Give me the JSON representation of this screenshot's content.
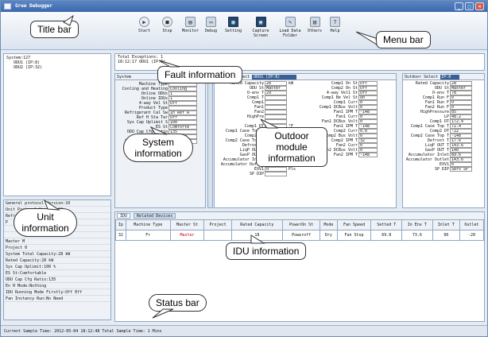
{
  "window": {
    "title": "Gree Debugger",
    "controls": [
      "_",
      "□",
      "×"
    ]
  },
  "toolbar": {
    "items": [
      {
        "label": "Start",
        "icon": "play-icon"
      },
      {
        "label": "Stop",
        "icon": "stop-icon"
      },
      {
        "label": "Monitor",
        "icon": "monitor-icon"
      },
      {
        "label": "Debug",
        "icon": "debug-icon"
      },
      {
        "label": "Setting",
        "icon": "setting-icon"
      },
      {
        "label": "Capture Screen",
        "icon": "capture-icon"
      },
      {
        "label": "Load Data Folder",
        "icon": "folder-icon"
      },
      {
        "label": "Others",
        "icon": "others-icon"
      },
      {
        "label": "Help",
        "icon": "help-icon"
      }
    ]
  },
  "tree": {
    "root": "System:127",
    "children": [
      "ODU1 (IP:8)",
      "ODU2 (IP:32)"
    ]
  },
  "unit_info": {
    "items": [
      "General protocol Version:10",
      "Unit Protocol Version:10",
      "Refrigerant",
      "P",
      "",
      "",
      "Master M",
      "Project 0",
      "System Total Capacity:28 kW",
      "Rated Capacity:28 kW",
      "Sys Cap Uplimit:100 %",
      "ES St:Comfortable",
      "ODU Cap Cfg Ratio:135",
      "En H Mode:Nothing",
      "IDU Running Mode Firstly:Off Eff",
      "Fan Instancy Run:No Need"
    ]
  },
  "fault": {
    "total_label": "Total Exceptions: 1",
    "line": "18:12:17 ODU1 (IP:8)"
  },
  "system": {
    "header": "System",
    "rows": [
      {
        "label": "Machine Type",
        "value": ""
      },
      {
        "label": "Cooling and Heating",
        "value": "Cooling"
      },
      {
        "label": "Online ODUs",
        "value": "1"
      },
      {
        "label": "Online IDUs",
        "value": "1"
      },
      {
        "label": "4-way Vel St",
        "value": "Off"
      },
      {
        "label": "Product Type",
        "value": ""
      },
      {
        "label": "Refrigerant Cal Sw",
        "value": "In Ref R"
      },
      {
        "label": "Ref H Sta Tar",
        "value": "Off"
      },
      {
        "label": "Sys Cap Uplimit S",
        "value": "100"
      },
      {
        "label": "ES St",
        "value": "Comforte"
      },
      {
        "label": "ODU Cap Cfg Ratio",
        "value": "135"
      },
      {
        "label": "En H Mode",
        "value": "Nothing"
      },
      {
        "label": "IDU Running Mode F",
        "value": "Off Effe"
      }
    ],
    "units": {
      "capacity": "%",
      "uplimit": "%"
    }
  },
  "outdoor": {
    "select_label": "Outdoor Select",
    "selected": "ODU1 (IP:8)",
    "left": [
      {
        "label": "Rated Capacity",
        "value": "28",
        "unit": "kW"
      },
      {
        "label": "ODU St",
        "value": "Master",
        "unit": ""
      },
      {
        "label": "O-env T",
        "value": "29",
        "unit": ""
      },
      {
        "label": "Comp1 T",
        "value": "",
        "unit": ""
      },
      {
        "label": "Comp1",
        "value": "",
        "unit": ""
      },
      {
        "label": "Fan1",
        "value": "",
        "unit": ""
      },
      {
        "label": "Fan2",
        "value": "",
        "unit": ""
      },
      {
        "label": "HighPre",
        "value": "",
        "unit": ""
      },
      {
        "label": "",
        "value": "",
        "unit": ""
      },
      {
        "label": "Comp1 DT",
        "value": "",
        "unit": "°F"
      },
      {
        "label": "Comp1 Case Top T",
        "value": "72.4",
        "unit": "°F"
      },
      {
        "label": "Comp2 DT",
        "value": "-22",
        "unit": "°F"
      },
      {
        "label": "Comp2 Case Top T",
        "value": "-148",
        "unit": "°F"
      },
      {
        "label": "Defrost T",
        "value": "17.6",
        "unit": "°F"
      },
      {
        "label": "LiqP OUT T",
        "value": "143.6",
        "unit": "°F"
      },
      {
        "label": "GasP OUT T",
        "value": "140",
        "unit": "°F"
      },
      {
        "label": "Accumulator Inlet",
        "value": "89.6",
        "unit": "°F"
      },
      {
        "label": "Accumulator Outlet",
        "value": "143.6",
        "unit": "°F"
      },
      {
        "label": "EXV1",
        "value": "0",
        "unit": "Pls"
      },
      {
        "label": "SP DIP",
        "value": "",
        "unit": ""
      }
    ],
    "right": [
      {
        "label": "Comp1 On St",
        "value": "Off"
      },
      {
        "label": "Comp2 On St",
        "value": "Off"
      },
      {
        "label": "4-way Vel1 St",
        "value": "Off"
      },
      {
        "label": "Comp1 Be Vel St",
        "value": "On"
      },
      {
        "label": "Comp1 Curr",
        "value": "0"
      },
      {
        "label": "Comp1 DCBus Volt",
        "value": "0"
      },
      {
        "label": "Fan1 IPM T",
        "value": "-148"
      },
      {
        "label": "Fan1 Curr",
        "value": "0"
      },
      {
        "label": "Fan1 DCBus Volt",
        "value": "0"
      },
      {
        "label": "Fan1 IPM T",
        "value": "-148"
      },
      {
        "label": "Comp2 Curr",
        "value": "0.0"
      },
      {
        "label": "Comp2 Bus Volt",
        "value": "0"
      },
      {
        "label": "Comp2 IPM T",
        "value": "32"
      },
      {
        "label": "Fan2 Curr",
        "value": "0"
      },
      {
        "label": "Fan2 DCBus Volt",
        "value": "0"
      },
      {
        "label": "Fan2 IPM T",
        "value": "-148"
      }
    ]
  },
  "outdoor2": {
    "select_label": "Outdoor Select",
    "selected": "IP:8",
    "rows": [
      {
        "label": "Rated Capacity",
        "value": "28"
      },
      {
        "label": "ODU St",
        "value": "Master"
      },
      {
        "label": "O-env T",
        "value": "78"
      },
      {
        "label": "Comp1 Run F",
        "value": "0"
      },
      {
        "label": "Fan1 Run F",
        "value": "0"
      },
      {
        "label": "Fan2 Run F",
        "value": "0"
      },
      {
        "label": "HighPressure",
        "value": "85"
      },
      {
        "label": "LP",
        "value": "48.2"
      },
      {
        "label": "Comp1 DT",
        "value": "172.4"
      },
      {
        "label": "Comp1 Case Top T",
        "value": "72.4"
      },
      {
        "label": "Comp2 DT",
        "value": "-22"
      },
      {
        "label": "Comp2 Case Top T",
        "value": "-148"
      },
      {
        "label": "Defrost T",
        "value": "17.6"
      },
      {
        "label": "LiqP OUT T",
        "value": "143.6"
      },
      {
        "label": "GasP OUT T",
        "value": "140"
      },
      {
        "label": "Accumulator Inlet",
        "value": "89.6"
      },
      {
        "label": "Accumulator Outlet",
        "value": "143.6"
      },
      {
        "label": "EXV1",
        "value": "0"
      },
      {
        "label": "SP DIP",
        "value": "Serv SP"
      }
    ]
  },
  "idu": {
    "tabs": [
      "IDU",
      "Related Devices"
    ],
    "columns": [
      "Ip",
      "Machine Type",
      "Master St",
      "Project",
      "Rated Capacity",
      "PowerOn St",
      "Mode",
      "Fan Speed",
      "Setted T",
      "In Env T",
      "Inlet T",
      "Outlet"
    ],
    "rows": [
      [
        "32",
        "Fr",
        "Master",
        "",
        "18",
        "Poweroff",
        "Dry",
        "Fan Stop",
        "69.8",
        "73.6",
        "90",
        "-20"
      ]
    ]
  },
  "status": {
    "text": "Current Sample Time: 2012-05-04 18:12:48  Total Sample Time: 1 Mins"
  },
  "callouts": {
    "title_bar": "Title bar",
    "menu_bar": "Menu bar",
    "fault_info": "Fault information",
    "outdoor_info": "Outdoor module information",
    "system_info": "System information",
    "unit_info": "Unit information",
    "idu_info": "IDU information",
    "status_bar": "Status bar"
  }
}
